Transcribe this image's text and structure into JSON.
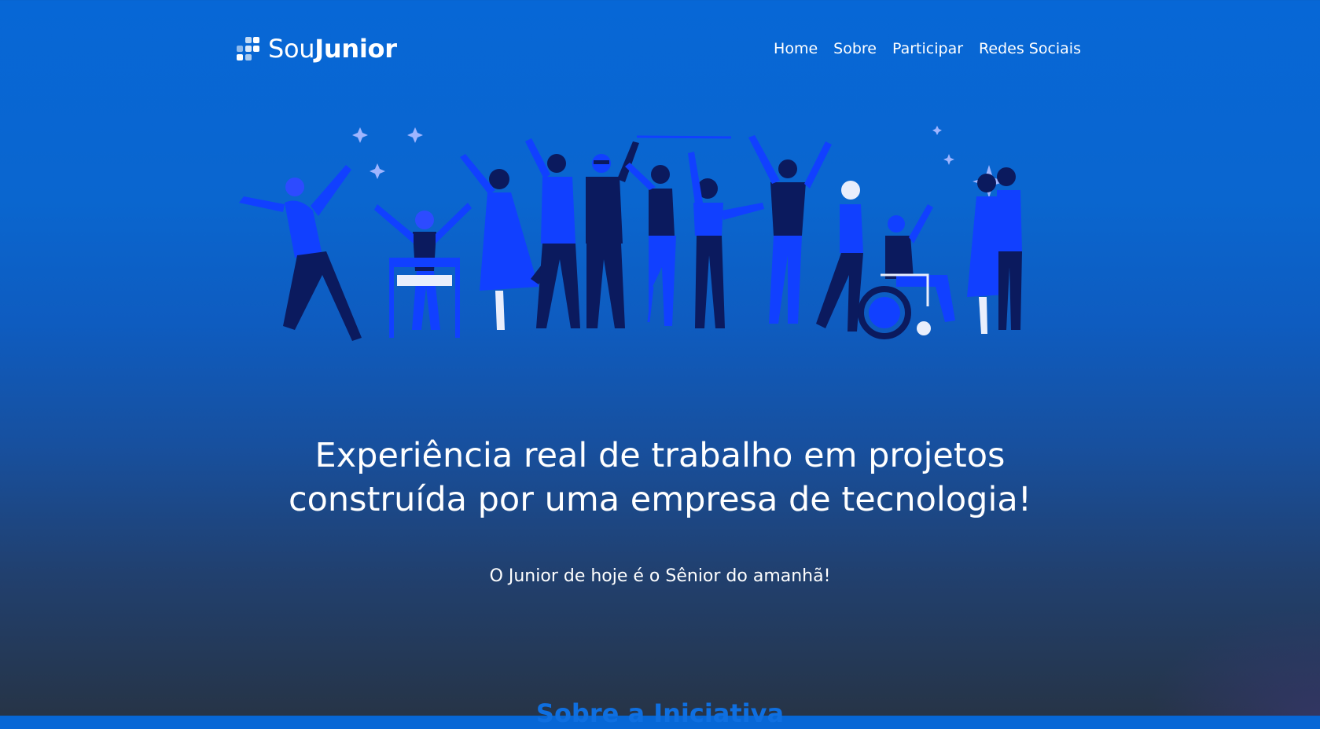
{
  "brand": {
    "name_light": "Sou",
    "name_bold": "Junior"
  },
  "nav": {
    "items": [
      "Home",
      "Sobre",
      "Participar",
      "Redes Sociais"
    ]
  },
  "hero": {
    "title_line1": "Experiência real de trabalho em projetos",
    "title_line2": "construída por uma empresa de tecnologia!",
    "subtitle": "O Junior de hoje é o Sênior do amanhã!"
  },
  "next_section": {
    "heading": "Sobre a Iniciativa"
  },
  "colors": {
    "accent": "#0f6fe0",
    "figure_blue": "#1140ff",
    "figure_navy": "#0b1a5e"
  },
  "icons": [
    "logo-grid-icon"
  ]
}
